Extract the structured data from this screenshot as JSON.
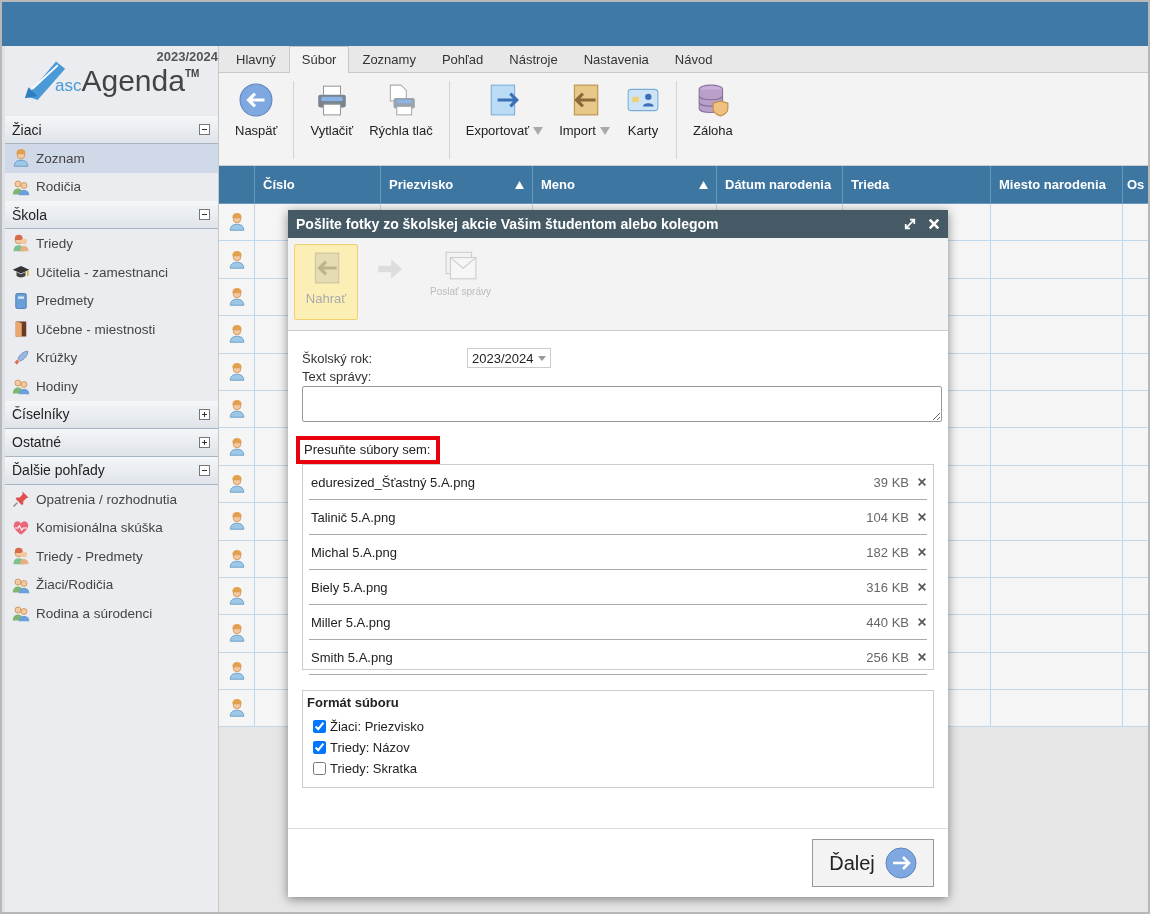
{
  "app": {
    "year": "2023/2024",
    "logo_prefix": "asc",
    "logo_name": "Agenda",
    "logo_mark": "TM"
  },
  "sidebar": {
    "sections": [
      {
        "title": "Žiaci",
        "expanded": true,
        "items": [
          {
            "label": "Zoznam",
            "kind": "student",
            "selected": true
          },
          {
            "label": "Rodičia",
            "kind": "family",
            "selected": false
          }
        ]
      },
      {
        "title": "Škola",
        "expanded": true,
        "items": [
          {
            "label": "Triedy",
            "kind": "class",
            "selected": false
          },
          {
            "label": "Učitelia - zamestnanci",
            "kind": "cap",
            "selected": false
          },
          {
            "label": "Predmety",
            "kind": "book",
            "selected": false
          },
          {
            "label": "Učebne - miestnosti",
            "kind": "door",
            "selected": false
          },
          {
            "label": "Krúžky",
            "kind": "rocket",
            "selected": false
          },
          {
            "label": "Hodiny",
            "kind": "family",
            "selected": false
          }
        ]
      },
      {
        "title": "Číselníky",
        "expanded": false
      },
      {
        "title": "Ostatné",
        "expanded": false
      },
      {
        "title": "Ďalšie pohľady",
        "expanded": true,
        "items": [
          {
            "label": "Opatrenia / rozhodnutia",
            "kind": "pin",
            "selected": false
          },
          {
            "label": "Komisionálna skúška",
            "kind": "heart",
            "selected": false
          },
          {
            "label": "Triedy - Predmety",
            "kind": "class",
            "selected": false
          },
          {
            "label": "Žiaci/Rodičia",
            "kind": "family",
            "selected": false
          },
          {
            "label": "Rodina a súrodenci",
            "kind": "family",
            "selected": false
          }
        ]
      }
    ]
  },
  "tabs": [
    {
      "label": "Hlavný",
      "selected": false
    },
    {
      "label": "Súbor",
      "selected": true
    },
    {
      "label": "Zoznamy",
      "selected": false
    },
    {
      "label": "Pohľad",
      "selected": false
    },
    {
      "label": "Nástroje",
      "selected": false
    },
    {
      "label": "Nastavenia",
      "selected": false
    },
    {
      "label": "Návod",
      "selected": false
    }
  ],
  "ribbon": {
    "groups": [
      [
        {
          "label": "Naspäť",
          "kind": "back",
          "dropdown": false
        }
      ],
      [
        {
          "label": "Vytlačiť",
          "kind": "printer",
          "dropdown": false
        },
        {
          "label": "Rýchla tlač",
          "kind": "quickprint",
          "dropdown": false
        }
      ],
      [
        {
          "label": "Exportovať",
          "kind": "export",
          "dropdown": true
        },
        {
          "label": "Import",
          "kind": "import",
          "dropdown": true
        },
        {
          "label": "Karty",
          "kind": "card",
          "dropdown": false
        }
      ],
      [
        {
          "label": "Záloha",
          "kind": "backup",
          "dropdown": false
        }
      ]
    ]
  },
  "table": {
    "columns": [
      {
        "label": "Číslo",
        "sorted": false
      },
      {
        "label": "Priezvisko",
        "sorted": true
      },
      {
        "label": "Meno",
        "sorted": true
      },
      {
        "label": "Dátum narodenia",
        "sorted": false
      },
      {
        "label": "Trieda",
        "sorted": false
      },
      {
        "label": "Miesto narodenia",
        "sorted": false
      },
      {
        "label": "Os",
        "sorted": false
      }
    ],
    "rows": [
      {
        "kind": "student"
      },
      {
        "kind": "student"
      },
      {
        "kind": "student"
      },
      {
        "kind": "student"
      },
      {
        "kind": "student"
      },
      {
        "kind": "student"
      },
      {
        "kind": "student"
      },
      {
        "kind": "student"
      },
      {
        "kind": "student"
      },
      {
        "kind": "student"
      },
      {
        "kind": "student"
      },
      {
        "kind": "student"
      },
      {
        "kind": "student"
      },
      {
        "kind": "student"
      }
    ]
  },
  "dialog": {
    "title": "Pošlite fotky zo školskej akcie Vašim študentom alebo kolegom",
    "steps": [
      {
        "label": "Nahrať",
        "kind": "upload",
        "selected": true
      },
      {
        "label": "Poslať správy",
        "kind": "mail",
        "selected": false
      }
    ],
    "school_year": {
      "label": "Školský rok:",
      "value": "2023/2024"
    },
    "message": {
      "label": "Text správy:"
    },
    "drop": {
      "label": "Presuňte súbory sem:",
      "highlighted": true
    },
    "files": [
      {
        "name": "eduresized_Šťastný 5.A.png",
        "size": "39 KB"
      },
      {
        "name": "Talinič 5.A.png",
        "size": "104 KB"
      },
      {
        "name": "Michal 5.A.png",
        "size": "182 KB"
      },
      {
        "name": "Biely 5.A.png",
        "size": "316 KB"
      },
      {
        "name": "Miller 5.A.png",
        "size": "440 KB"
      },
      {
        "name": "Smith 5.A.png",
        "size": "256 KB"
      }
    ],
    "format": {
      "title": "Formát súboru",
      "options": [
        {
          "label": "Žiaci: Priezvisko",
          "checked": true
        },
        {
          "label": "Triedy: Názov",
          "checked": true
        },
        {
          "label": "Triedy: Skratka",
          "checked": false
        }
      ]
    },
    "next": {
      "label": "Ďalej"
    }
  }
}
